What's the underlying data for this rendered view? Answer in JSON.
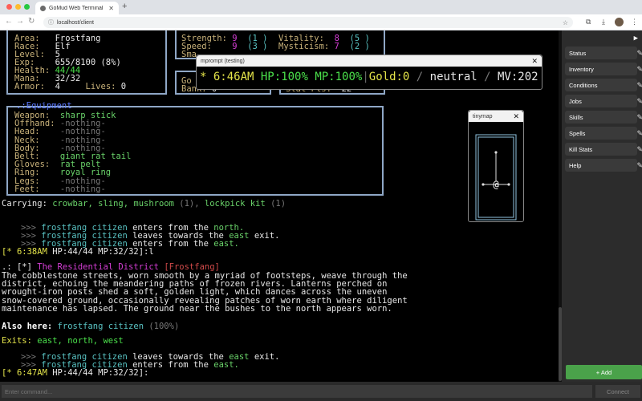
{
  "browser": {
    "tab_title": "GoMud Web Terminal",
    "url": "localhost/client",
    "new_tab": "+",
    "traffic": [
      "#ff5f57",
      "#febc2e",
      "#28c840"
    ]
  },
  "stats": {
    "area_label": "Area:",
    "area": "Frostfang",
    "race_label": "Race:",
    "race": "Elf",
    "level_label": "Level:",
    "level": "5",
    "exp_label": "Exp:",
    "exp": "655/8100 (8%)",
    "health_label": "Health:",
    "health": "44/44",
    "mana_label": "Mana:",
    "mana": "32/32",
    "armor_label": "Armor:",
    "armor": "4",
    "lives_label": "Lives:",
    "lives": "0"
  },
  "attributes": {
    "strength_label": "Strength:",
    "strength": "9",
    "strength_mod": "(1 )",
    "vitality_label": "Vitality:",
    "vitality": "8",
    "vitality_mod": "(5 )",
    "speed_label": "Speed:",
    "speed": "9",
    "speed_mod": "(3 )",
    "mysticism_label": "Mysticism:",
    "mysticism": "7",
    "mysticism_mod": "(2 )",
    "gold_frag": "Go",
    "bank_label": "Bank:",
    "bank": "0",
    "statpts_label": "Stat Pts:",
    "statpts": "22",
    "sm_frag": "Sma"
  },
  "equipment": {
    "header": ".:Equipment",
    "slots": [
      {
        "label": "Weapon:",
        "value": "sharp stick",
        "empty": false
      },
      {
        "label": "Offhand:",
        "value": "-nothing-",
        "empty": true
      },
      {
        "label": "Head:",
        "value": "-nothing-",
        "empty": true
      },
      {
        "label": "Neck:",
        "value": "-nothing-",
        "empty": true
      },
      {
        "label": "Body:",
        "value": "-nothing-",
        "empty": true
      },
      {
        "label": "Belt:",
        "value": "giant rat tail",
        "empty": false
      },
      {
        "label": "Gloves:",
        "value": "rat pelt",
        "empty": false
      },
      {
        "label": "Ring:",
        "value": "royal ring",
        "empty": false
      },
      {
        "label": "Legs:",
        "value": "-nothing-",
        "empty": true
      },
      {
        "label": "Feet:",
        "value": "-nothing-",
        "empty": true
      }
    ]
  },
  "carrying": {
    "label": "Carrying:",
    "items": "crowbar, sling, mushroom",
    "mushroom_count": " (1), ",
    "lockpick": "lockpick kit",
    "lockpick_count": " (1)"
  },
  "log": {
    "arrow": ">>>",
    "npc": "frostfang citizen",
    "l1_action": "enters from the",
    "l1_dir": "north.",
    "l2_action": "leaves towards the",
    "l2_dir": "east",
    "l2_end": "exit.",
    "l3_action": "enters from the",
    "l3_dir": "east.",
    "prompt1_time": "[* 6:38AM",
    "prompt1_hp": "HP:44/44",
    "prompt1_mp": "MP:32/32]",
    "prompt1_cmd": ":l",
    "room_prefix": ".: [*]",
    "room_name": "The Residential District",
    "room_zone": "[Frostfang]",
    "desc": [
      "The cobblestone streets, worn smooth by a myriad of footsteps, weave through the",
      "district, echoing the meandering paths of frozen rivers. Lanterns perched on",
      "wrought-iron posts shed a soft, golden light, which dances across the uneven",
      "snow-covered ground, occasionally revealing patches of worn earth where diligent",
      "maintenance has lapsed. The ground near the bushes to the north appears worn."
    ],
    "also_here_label": "Also here:",
    "also_here_npc": "frostfang citizen",
    "also_here_pct": "(100%)",
    "exits_label": "Exits:",
    "exits": "east, north, west",
    "l4_action": "leaves towards the",
    "l4_dir": "east",
    "l4_end": "exit.",
    "l5_action": "enters from the",
    "l5_dir": "east.",
    "prompt2_time": "[* 6:47AM",
    "prompt2_hp": "HP:44/44",
    "prompt2_mp": "MP:32/32]",
    "prompt2_cmd": ":"
  },
  "mprompt": {
    "title": "mprompt (testing)",
    "time": "* 6:46AM",
    "hp": "HP:100%",
    "mp": "MP:100%",
    "gold": "Gold:0",
    "align": "neutral",
    "mv": "MV:202"
  },
  "tinymap": {
    "title": "tinymap",
    "player": "@"
  },
  "sidebar": {
    "items": [
      {
        "label": "Status"
      },
      {
        "label": "Inventory"
      },
      {
        "label": "Conditions"
      },
      {
        "label": "Jobs"
      },
      {
        "label": "Skills"
      },
      {
        "label": "Spells"
      },
      {
        "label": "Kill Stats"
      },
      {
        "label": "Help"
      }
    ],
    "add_label": "+ Add"
  },
  "input": {
    "placeholder": "Enter command...",
    "connect_label": "Connect"
  }
}
